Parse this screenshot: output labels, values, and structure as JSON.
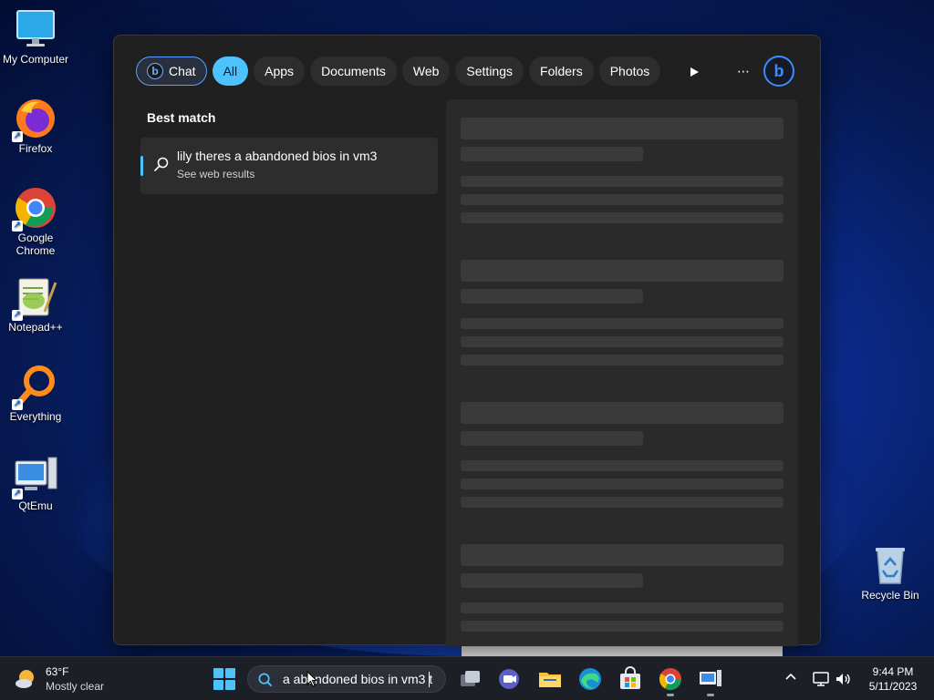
{
  "desktop": {
    "icons": [
      {
        "label": "My Computer"
      },
      {
        "label": "Firefox"
      },
      {
        "label": "Google Chrome"
      },
      {
        "label": "Notepad++"
      },
      {
        "label": "Everything"
      },
      {
        "label": "QtEmu"
      }
    ],
    "recycle_bin": "Recycle Bin"
  },
  "search_panel": {
    "filters": [
      "Chat",
      "All",
      "Apps",
      "Documents",
      "Web",
      "Settings",
      "Folders",
      "Photos"
    ],
    "active_filter": "All",
    "best_match_title": "Best match",
    "best_match": {
      "query": "lily theres a abandoned bios in vm3",
      "subtitle": "See web results"
    }
  },
  "taskbar": {
    "weather_temp": "63°F",
    "weather_desc": "Mostly clear",
    "search_value": "a abandoned bios in vm3 t",
    "time": "9:44 PM",
    "date": "5/11/2023"
  },
  "colors": {
    "accent": "#4cc2ff",
    "panel_bg": "#202020",
    "taskbar_bg": "#1c1f26"
  }
}
